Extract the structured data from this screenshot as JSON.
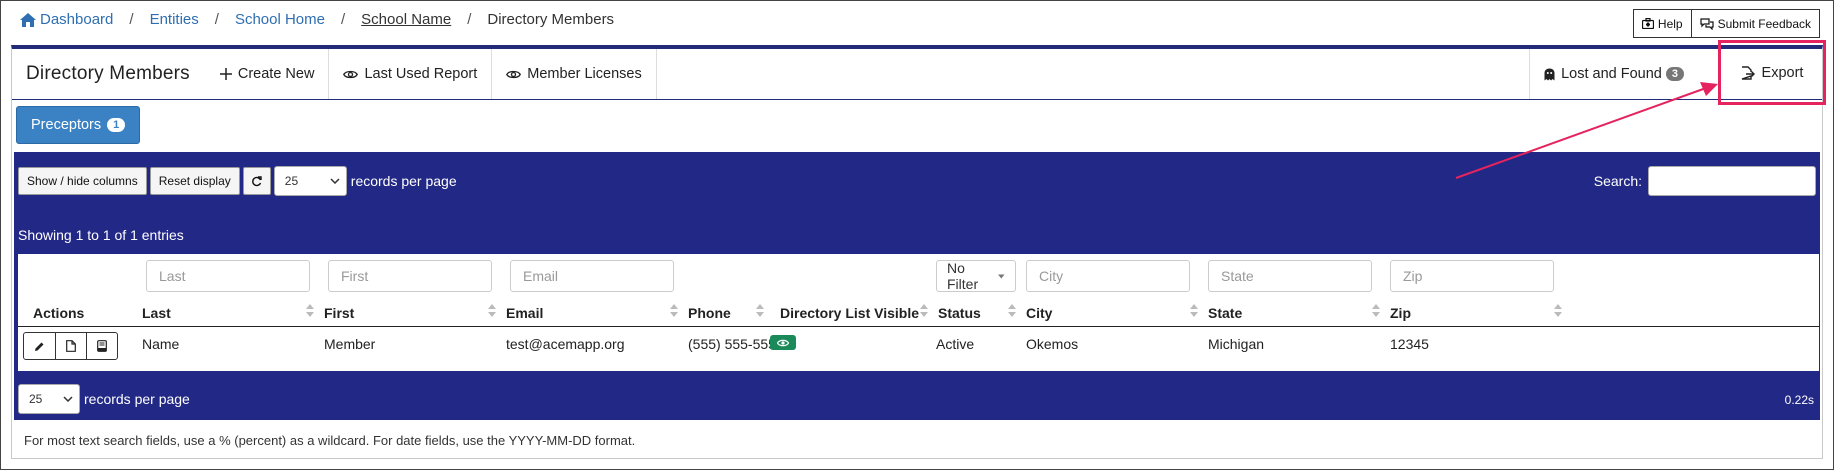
{
  "breadcrumb": {
    "items": [
      "Dashboard",
      "Entities",
      "School Home",
      "School Name"
    ],
    "current": "Directory Members"
  },
  "top_buttons": {
    "help": "Help",
    "feedback": "Submit Feedback"
  },
  "toolbar": {
    "title": "Directory Members",
    "create_new": "Create New",
    "last_used_report": "Last Used Report",
    "member_licenses": "Member Licenses",
    "lost_and_found": "Lost and Found",
    "lost_and_found_count": "3",
    "export": "Export"
  },
  "tabs": [
    {
      "label": "Preceptors",
      "count": "1"
    }
  ],
  "controls": {
    "show_hide": "Show / hide columns",
    "reset": "Reset display",
    "per_page_value": "25",
    "per_page_label": "records per page",
    "search_label": "Search:",
    "showing": "Showing 1 to 1 of 1 entries",
    "timing": "0.22s"
  },
  "filters": {
    "last": "Last",
    "first": "First",
    "email": "Email",
    "dir_visible": "No Filter",
    "city": "City",
    "state": "State",
    "zip": "Zip"
  },
  "columns": [
    "Actions",
    "Last",
    "First",
    "Email",
    "Phone",
    "Directory List Visible",
    "Status",
    "City",
    "State",
    "Zip"
  ],
  "rows": [
    {
      "last": "Name",
      "first": "Member",
      "email": "test@acemapp.org",
      "phone": "(555) 555-5555",
      "status": "Active",
      "city": "Okemos",
      "state": "Michigan",
      "zip": "12345"
    }
  ],
  "footnote": "For most text search fields, use a % (percent) as a wildcard. For date fields, use the YYYY-MM-DD format.",
  "colors": {
    "navy": "#222886",
    "accent": "#e5245f",
    "tab_blue": "#3b82c4",
    "green": "#1a8a5a"
  },
  "icons": [
    "home-icon",
    "help-icon",
    "feedback-icon",
    "plus-icon",
    "eye-icon",
    "ghost-icon",
    "export-icon",
    "refresh-icon",
    "pencil-icon",
    "file-icon",
    "book-icon"
  ]
}
